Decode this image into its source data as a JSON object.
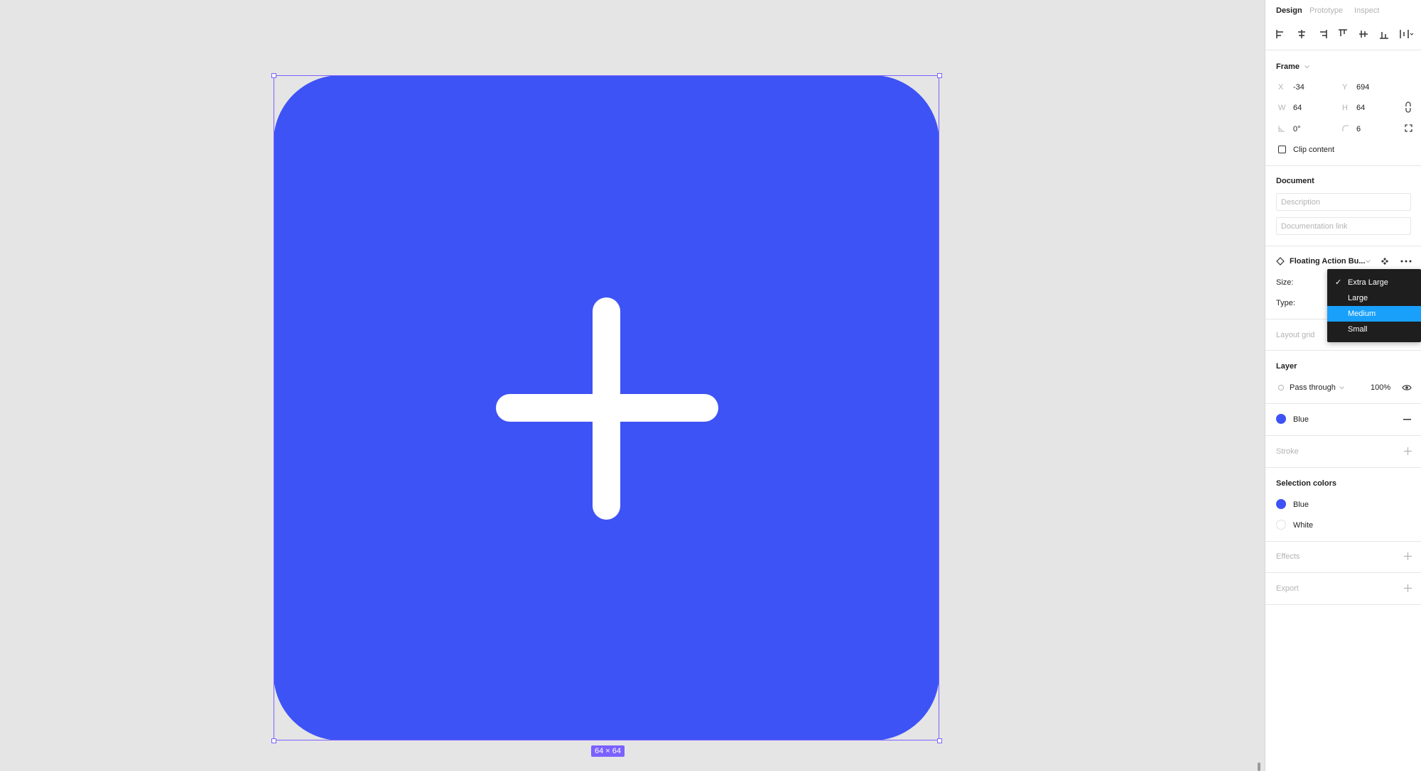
{
  "canvas": {
    "component_color": "#3e53f5",
    "selection_color": "#7b61ff",
    "size_badge": "64 × 64"
  },
  "panel": {
    "tabs": [
      "Design",
      "Prototype",
      "Inspect"
    ],
    "frame": {
      "title": "Frame",
      "x_label": "X",
      "x_value": "-34",
      "y_label": "Y",
      "y_value": "694",
      "w_label": "W",
      "w_value": "64",
      "h_label": "H",
      "h_value": "64",
      "rotation_value": "0°",
      "radius_value": "6",
      "clip_content_label": "Clip content"
    },
    "document": {
      "title": "Document",
      "description_placeholder": "Description",
      "doc_link_placeholder": "Documentation link"
    },
    "component": {
      "name": "Floating Action Bu...",
      "size_label": "Size:",
      "type_label": "Type:"
    },
    "layout_grid": {
      "title": "Layout grid"
    },
    "layer": {
      "title": "Layer",
      "blend_mode": "Pass through",
      "opacity": "100%"
    },
    "fill": {
      "name": "Blue",
      "color": "#3e53f5"
    },
    "stroke": {
      "title": "Stroke"
    },
    "selection_colors": {
      "title": "Selection colors",
      "items": [
        {
          "name": "Blue",
          "color": "#3e53f5"
        },
        {
          "name": "White",
          "color": "#ffffff"
        }
      ]
    },
    "effects": {
      "title": "Effects"
    },
    "export": {
      "title": "Export"
    }
  },
  "dropdown": {
    "items": [
      "Extra Large",
      "Large",
      "Medium",
      "Small"
    ],
    "checked": "Extra Large",
    "highlighted": "Medium"
  }
}
